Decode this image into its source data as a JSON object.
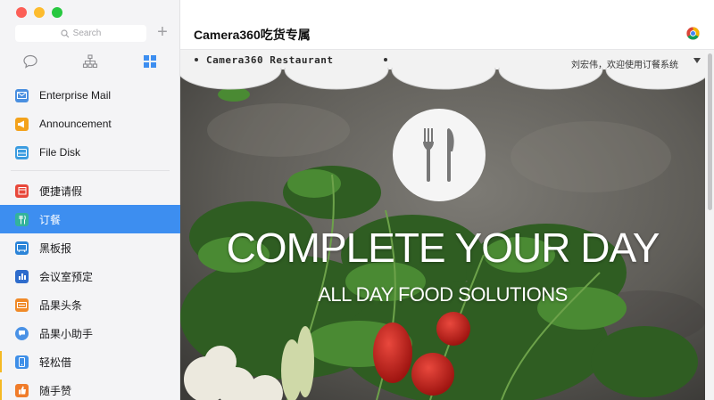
{
  "sidebar": {
    "search_placeholder": "Search",
    "add_symbol": "+",
    "items": [
      {
        "label": "Enterprise Mail",
        "color": "#4a8fe0"
      },
      {
        "label": "Announcement",
        "color": "#f3a21b"
      },
      {
        "label": "File Disk",
        "color": "#3b9ce0"
      },
      {
        "label": "便捷请假",
        "color": "#e8483b"
      },
      {
        "label": "订餐",
        "color": "#33b39b"
      },
      {
        "label": "黑板报",
        "color": "#2b84d8"
      },
      {
        "label": "会议室预定",
        "color": "#2e6ccc"
      },
      {
        "label": "品果头条",
        "color": "#f08a28"
      },
      {
        "label": "品果小助手",
        "color": "#4a92e6"
      },
      {
        "label": "轻松借",
        "color": "#3e8fe8"
      },
      {
        "label": "随手赞",
        "color": "#f07c2a"
      }
    ]
  },
  "main": {
    "title": "Camera360吃货专属",
    "page": {
      "brand": "Camera360 Restaurant",
      "welcome": "刘宏伟，欢迎使用订餐系统",
      "headline": "COMPLETE YOUR DAY",
      "subline": "ALL DAY FOOD SOLUTIONS"
    }
  },
  "colors": {
    "accent": "#3d8ef0",
    "flag": "#f5b923"
  }
}
